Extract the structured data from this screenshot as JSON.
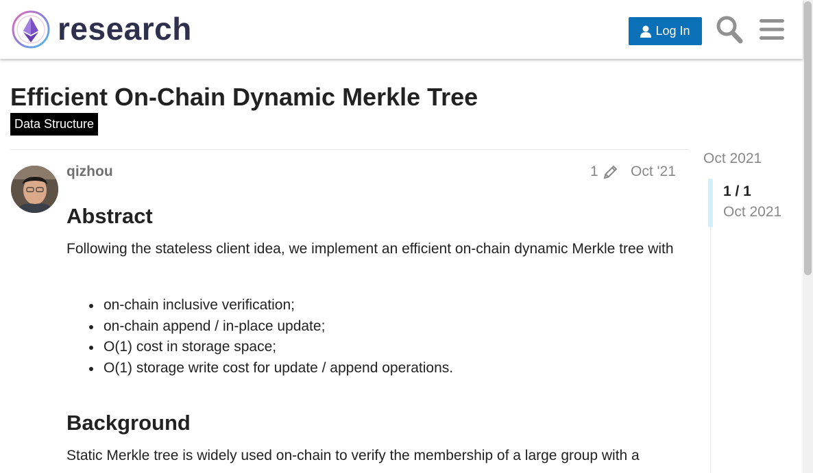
{
  "header": {
    "site_name": "research",
    "login_label": "Log In",
    "icons": {
      "search": "search-icon",
      "menu": "hamburger-menu-icon",
      "user": "user-icon"
    },
    "accent_color": "#0a70b8"
  },
  "topic": {
    "title": "Efficient On-Chain Dynamic Merkle Tree",
    "category": "Data Structure",
    "category_color": "#000000"
  },
  "post": {
    "username": "qizhou",
    "edit_count": "1",
    "date": "Oct '21",
    "abstract_heading": "Abstract",
    "abstract_text": "Following the stateless client idea, we implement an efficient on-chain dynamic Merkle tree with",
    "bullets": [
      "on-chain inclusive verification;",
      "on-chain append / in-place update;",
      "O(1) cost in storage space;",
      "O(1) storage write cost for update / append operations."
    ],
    "background_heading": "Background",
    "background_text": "Static Merkle tree is widely used on-chain to verify the membership of a large group with a"
  },
  "timeline": {
    "start_date": "Oct 2021",
    "position": "1 / 1",
    "current_date": "Oct 2021"
  }
}
